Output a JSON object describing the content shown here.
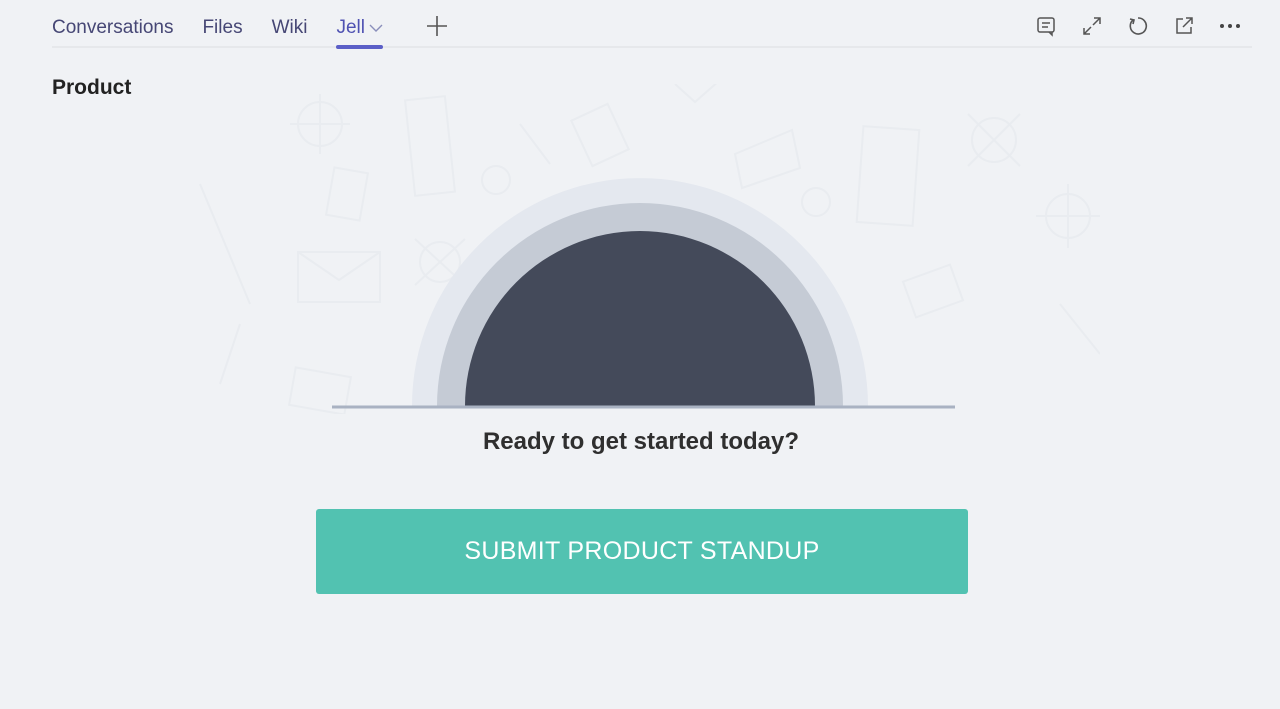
{
  "tabs": [
    {
      "label": "Conversations"
    },
    {
      "label": "Files"
    },
    {
      "label": "Wiki"
    },
    {
      "label": "Jell",
      "active": true,
      "has_dropdown": true
    }
  ],
  "icons": {
    "add_tab": "plus-icon",
    "tools": [
      "conversation-icon",
      "expand-icon",
      "refresh-icon",
      "popout-icon",
      "more-icon"
    ]
  },
  "page": {
    "title": "Product",
    "prompt": "Ready to get started today?",
    "cta_label": "SUBMIT PRODUCT STANDUP"
  },
  "colors": {
    "accent": "#5b5fc7",
    "cta": "#52c2b1",
    "sun": "#444a5a",
    "ring_inner": "#c5cbd5",
    "ring_outer": "#e4e8ef",
    "background": "#f0f2f5"
  }
}
